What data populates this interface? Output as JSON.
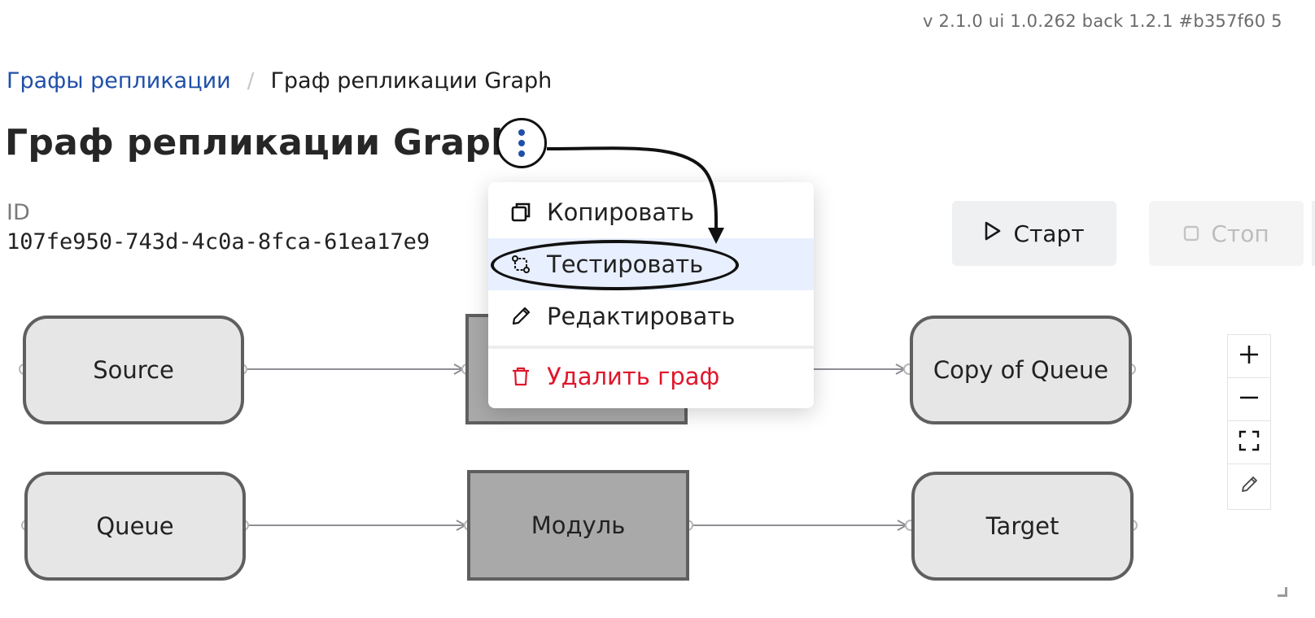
{
  "header": {
    "version": "v 2.1.0  ui 1.0.262  back 1.2.1  #b357f60 5"
  },
  "breadcrumb": {
    "parent": "Графы репликации",
    "separator": "/",
    "current": "Граф репликации Graph"
  },
  "page": {
    "title": "Граф репликации Graph",
    "id_label": "ID",
    "id_value": "107fe950-743d-4c0a-8fca-61ea17e9"
  },
  "actions": {
    "start_label": "Старт",
    "stop_label": "Стоп",
    "stop_disabled": true
  },
  "menu": {
    "items": [
      {
        "label": "Копировать",
        "icon": "copy-icon"
      },
      {
        "label": "Тестировать",
        "icon": "test-icon",
        "highlighted": true
      },
      {
        "label": "Редактировать",
        "icon": "pencil-icon"
      },
      {
        "label": "Удалить граф",
        "icon": "trash-icon",
        "danger": true
      }
    ]
  },
  "graph": {
    "nodes": [
      {
        "id": "source",
        "label": "Source",
        "shape": "rounded"
      },
      {
        "id": "module-top",
        "label": "",
        "shape": "square"
      },
      {
        "id": "copy-of-queue",
        "label": "Copy of Queue",
        "shape": "rounded"
      },
      {
        "id": "queue",
        "label": "Queue",
        "shape": "rounded"
      },
      {
        "id": "module",
        "label": "Модуль",
        "shape": "square"
      },
      {
        "id": "target",
        "label": "Target",
        "shape": "rounded"
      }
    ],
    "edges": [
      [
        "source",
        "module-top"
      ],
      [
        "module-top",
        "copy-of-queue"
      ],
      [
        "queue",
        "module"
      ],
      [
        "module",
        "target"
      ]
    ]
  },
  "zoom_controls": [
    {
      "icon": "plus-icon"
    },
    {
      "icon": "minus-icon"
    },
    {
      "icon": "fit-view-icon"
    },
    {
      "icon": "pencil-icon"
    }
  ],
  "colors": {
    "link": "#1f4fa8",
    "danger": "#e0162b",
    "highlight": "#e8efff",
    "node_round_fill": "#e6e6e6",
    "node_square_fill": "#a9a9a9",
    "node_border": "#5f5f5f",
    "edge": "#8e8e95"
  }
}
